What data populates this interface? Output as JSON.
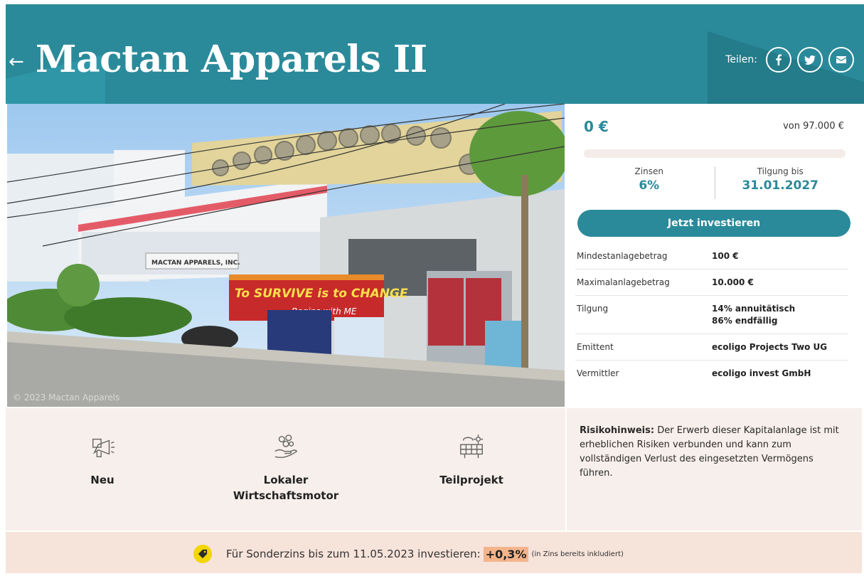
{
  "header": {
    "back_icon": "arrow-left-icon",
    "title": "Mactan Apparels II",
    "share_label": "Teilen:",
    "share_buttons": [
      {
        "icon": "facebook-icon"
      },
      {
        "icon": "twitter-icon"
      },
      {
        "icon": "mail-icon"
      }
    ],
    "background_color": "#2a8a9a"
  },
  "photo": {
    "watermark": "© 2023 Mactan Apparels",
    "banner_text": "To SURVIVE is to CHANGE",
    "banner_subtext": "Begins with ME",
    "building_sign": "MACTAN APPARELS, INC."
  },
  "invest": {
    "amount": "0 €",
    "target": "von 97.000 €",
    "funded_fraction": 0,
    "interest_label": "Zinsen",
    "interest_value": "6%",
    "repayment_label": "Tilgung bis",
    "repayment_value": "31.01.2027",
    "cta_label": "Jetzt investieren",
    "details": [
      {
        "key": "Mindestanlagebetrag",
        "value": "100 €"
      },
      {
        "key": "Maximalanlagebetrag",
        "value": "10.000 €"
      },
      {
        "key": "Tilgung",
        "value": "14% annuitätisch",
        "value2": "86% endfällig"
      },
      {
        "key": "Emittent",
        "value": "ecoligo Projects Two UG"
      },
      {
        "key": "Vermittler",
        "value": "ecoligo invest GmbH"
      }
    ],
    "accent_color": "#2a8a9a"
  },
  "features": [
    {
      "icon": "megaphone-icon",
      "label": "Neu"
    },
    {
      "icon": "hand-coins-icon",
      "label": "Lokaler Wirtschaftsmotor"
    },
    {
      "icon": "solar-panel-icon",
      "label": "Teilprojekt"
    }
  ],
  "risk": {
    "title": "Risikohinweis:",
    "text": "Der Erwerb dieser Kapitalanlage ist mit erheblichen Risiken verbunden und kann zum vollständigen Verlust des eingesetzten Vermögens führen."
  },
  "banner": {
    "icon": "tag-icon",
    "text": "Für Sonderzins bis zum 11.05.2023 investieren:",
    "bonus": "+0,3%",
    "note": "(in Zins bereits inkludiert)"
  }
}
